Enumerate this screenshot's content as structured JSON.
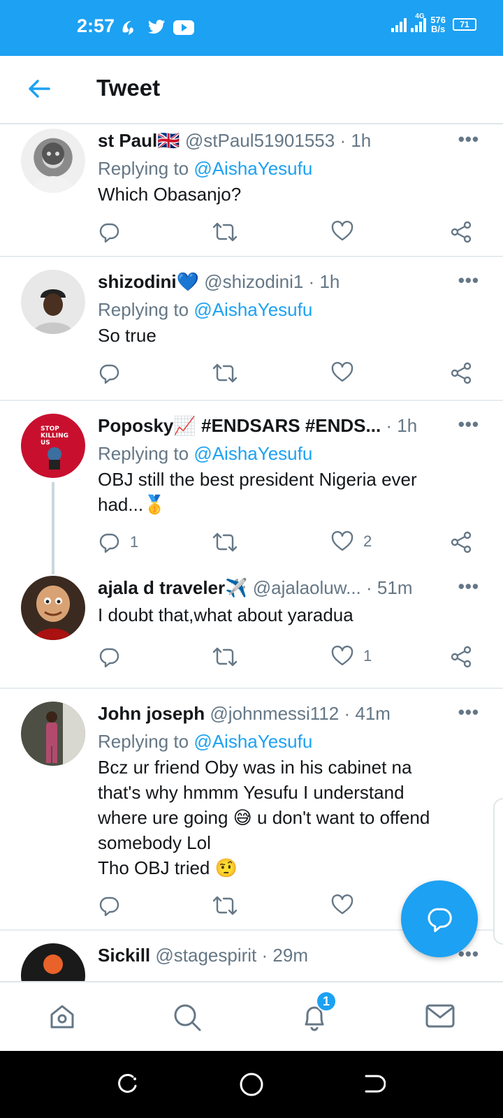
{
  "status_bar": {
    "time": "2:57",
    "network": "4G",
    "speed_value": "576",
    "speed_unit": "B/s",
    "battery": "71",
    "icons": [
      "hotspot-icon",
      "twitter-icon",
      "youtube-icon"
    ]
  },
  "header": {
    "title": "Tweet",
    "back_icon": "back-arrow-icon"
  },
  "colors": {
    "accent": "#1da1f2",
    "text": "#14171a",
    "secondary": "#657786",
    "divider": "#e6ecf0"
  },
  "tweets": [
    {
      "name": "st Paul",
      "name_emoji": "🇬🇧",
      "handle": "@stPaul51901553",
      "time": "1h",
      "replying_label": "Replying to",
      "replying_to": "@AishaYesufu",
      "text": "Which Obasanjo?",
      "reply_count": "",
      "retweet_count": "",
      "like_count": ""
    },
    {
      "name": "shizodini",
      "name_emoji": "💙",
      "handle": "@shizodini1",
      "time": "1h",
      "replying_label": "Replying to",
      "replying_to": "@AishaYesufu",
      "text": "So true",
      "reply_count": "",
      "retweet_count": "",
      "like_count": ""
    },
    {
      "name": "Poposky",
      "name_emoji": "📈",
      "handle": "#ENDSARS #ENDS...",
      "time": "1h",
      "replying_label": "Replying to",
      "replying_to": "@AishaYesufu",
      "text_line1": "OBJ still the best president Nigeria ever",
      "text_line2": "had...🥇",
      "reply_count": "1",
      "retweet_count": "",
      "like_count": "2"
    },
    {
      "name": "ajala d traveler",
      "name_emoji": "✈️",
      "handle": "@ajalaoluw...",
      "time": "51m",
      "text": "I doubt that,what about yaradua",
      "reply_count": "",
      "retweet_count": "",
      "like_count": "1"
    },
    {
      "name": "John joseph",
      "handle": "@johnmessi112",
      "time": "41m",
      "replying_label": "Replying to",
      "replying_to": "@AishaYesufu",
      "text_line1": "Bcz ur friend Oby was in his cabinet na",
      "text_line2": "that's why hmmm Yesufu I understand",
      "text_line3": "where ure going 😅 u don't want to offend",
      "text_line4": "somebody Lol",
      "text_line5": "Tho OBJ tried 🤨",
      "reply_count": "",
      "retweet_count": "",
      "like_count": ""
    },
    {
      "name": "Sickill",
      "handle": "@stagespirit",
      "time": "29m"
    }
  ],
  "bottom_nav": {
    "items": [
      "home-icon",
      "search-icon",
      "notifications-icon",
      "messages-icon"
    ],
    "notification_badge": "1"
  },
  "system_nav": [
    "recent-apps-icon",
    "home-circle-icon",
    "back-icon"
  ]
}
